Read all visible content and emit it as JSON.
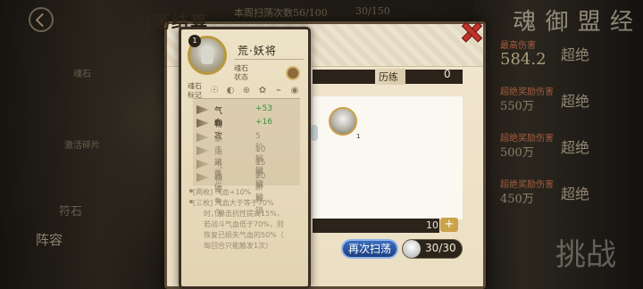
{
  "background": {
    "top_text": "本周扫荡次数56/100",
    "top_count": "30/150",
    "title_corner": "魂 御 盟 经",
    "left_labels": [
      "魂石",
      "激活碎片",
      "符石",
      "阵容"
    ],
    "right_rows": [
      {
        "title": "最高伤害",
        "value": "584.2",
        "tag": "超绝"
      },
      {
        "title": "超绝奖励伤害",
        "value": "550万",
        "tag": "超绝"
      },
      {
        "title": "超绝奖励伤害",
        "value": "500万",
        "tag": "超绝"
      },
      {
        "title": "超绝奖励伤害",
        "value": "450万",
        "tag": "超绝"
      }
    ],
    "challenge": "挑战"
  },
  "panel": {
    "title": "扫荡结算",
    "progress_label": "历练",
    "progress_value": "0",
    "reward_level": "1",
    "sweep_count": "10",
    "plus_label": "+",
    "sweep_button": "再次扫荡",
    "stamina": "30/30"
  },
  "card": {
    "level": "1",
    "name": "荒·妖将",
    "state_label": "魂石状态",
    "mark_label": "魂石标记",
    "marks": [
      "☉",
      "◐",
      "⊕",
      "✿",
      "⌁",
      "◉"
    ],
    "stats": [
      {
        "name": "气血",
        "value": "+53",
        "locked": false
      },
      {
        "name": "物攻",
        "value": "+16",
        "locked": false
      },
      {
        "name": "暴击抗性",
        "value": "5阶解锁",
        "locked": true
      },
      {
        "name": "法术免伤",
        "value": "10阶解锁",
        "locked": true
      },
      {
        "name": "气血",
        "value": "15阶解锁",
        "locked": true
      },
      {
        "name": "物理免伤",
        "value": "20阶解锁",
        "locked": true
      }
    ],
    "desc": [
      "[两枚] 气血+10%",
      "[三枚] 气血大于等于70%",
      "时，暴击抗性提高15%，",
      "若战斗气血低于70%，则",
      "恢复已损失气血的50%（",
      "每回合只能触发1次）"
    ]
  }
}
